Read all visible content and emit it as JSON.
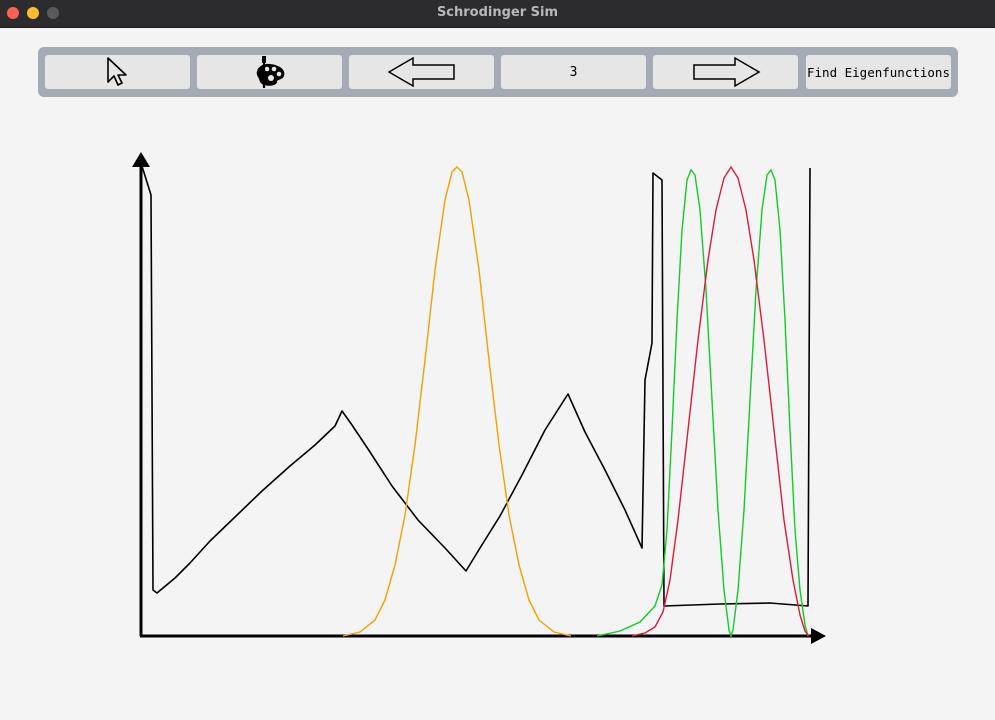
{
  "window": {
    "title": "Schrodinger Sim"
  },
  "toolbar": {
    "pointer_icon": "cursor-arrow-icon",
    "paint_icon": "palette-brush-icon",
    "prev_icon": "arrow-left-icon",
    "eigen_index": "3",
    "next_icon": "arrow-right-icon",
    "find_label": "Find Eigenfunctions"
  },
  "chart_data": {
    "type": "line",
    "title": "",
    "xlabel": "",
    "ylabel": "",
    "grid": false,
    "series": [
      {
        "color": "#000000",
        "role": "potential"
      },
      {
        "color": "#f5a000",
        "role": "eigenfunction"
      },
      {
        "color": "#13cc2a",
        "role": "eigenfunction"
      },
      {
        "color": "#d81e3c",
        "role": "eigenfunction"
      }
    ]
  }
}
